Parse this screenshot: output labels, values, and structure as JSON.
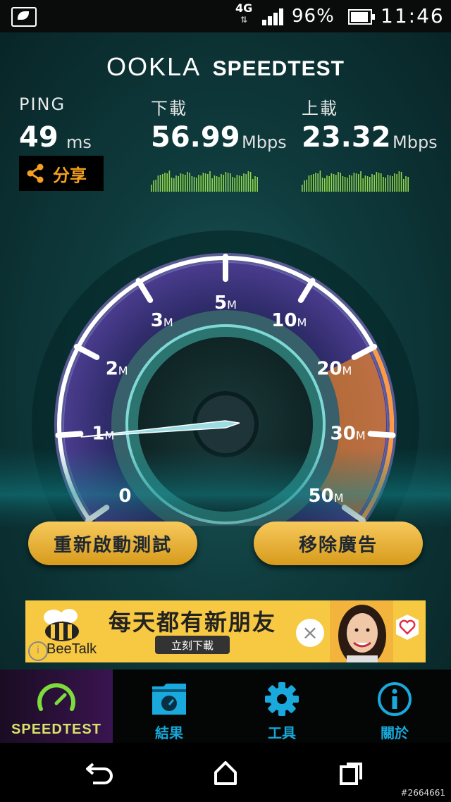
{
  "status_bar": {
    "network": "4G",
    "battery_percent": "96%",
    "time": "11:46",
    "signal_level": 4
  },
  "header": {
    "brand_name": "OOKLA",
    "brand_product": "SPEEDTEST"
  },
  "metrics": {
    "ping_label": "PING",
    "ping_value": "49",
    "ping_unit": "ms",
    "download_label": "下載",
    "download_value": "56.99",
    "download_unit": "Mbps",
    "upload_label": "上載",
    "upload_value": "23.32",
    "upload_unit": "Mbps",
    "share_label": "分享"
  },
  "gauge": {
    "ticks": [
      {
        "num": "0",
        "unit": ""
      },
      {
        "num": "1",
        "unit": "M"
      },
      {
        "num": "2",
        "unit": "M"
      },
      {
        "num": "3",
        "unit": "M"
      },
      {
        "num": "5",
        "unit": "M"
      },
      {
        "num": "10",
        "unit": "M"
      },
      {
        "num": "20",
        "unit": "M"
      },
      {
        "num": "30",
        "unit": "M"
      },
      {
        "num": "50",
        "unit": "M"
      }
    ],
    "needle_tick_fraction": 0.12,
    "accent_color": "#e3822b",
    "ring_color": "#9b82e6"
  },
  "buttons": {
    "restart": "重新啟動測試",
    "remove_ads": "移除廣告"
  },
  "ad": {
    "brand": "BeeTalk",
    "headline": "每天都有新朋友",
    "cta": "立刻下載",
    "close": "×",
    "info": "i"
  },
  "tabs": [
    {
      "label": "SPEEDTEST",
      "icon": "speedometer-icon"
    },
    {
      "label": "結果",
      "icon": "results-folder-icon"
    },
    {
      "label": "工具",
      "icon": "gear-icon"
    },
    {
      "label": "關於",
      "icon": "info-icon"
    }
  ],
  "watermark": "#2664661"
}
